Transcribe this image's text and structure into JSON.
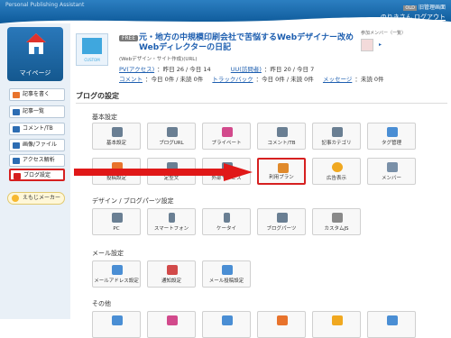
{
  "header": {
    "brand": "Personal Publishing Assistant",
    "old_tag": "OLD",
    "old_link": "旧管理画面",
    "user_name": "のりきさん",
    "logout": "ログアウト"
  },
  "sidebar": {
    "mypage": "マイページ",
    "items": [
      {
        "label": "記事を書く",
        "icon": "pencil-icon",
        "color": "#e8732c"
      },
      {
        "label": "記事一覧",
        "icon": "list-icon",
        "color": "#2d6db3"
      },
      {
        "label": "コメント/TB",
        "icon": "comment-icon",
        "color": "#2d6db3"
      },
      {
        "label": "画像/ファイル",
        "icon": "image-icon",
        "color": "#2d6db3"
      },
      {
        "label": "アクセス解析",
        "icon": "bar-chart-icon",
        "color": "#2d6db3"
      },
      {
        "label": "ブログ設定",
        "icon": "wrench-icon",
        "color": "#d62020"
      }
    ],
    "ebiji": "えもじメーカー"
  },
  "blog": {
    "thumb_label": "CUSTOM",
    "plan_badge": "FREE",
    "title": "元・地方の中規模印刷会社で苦悩するWebデザイナー改めWebディレクターの日記",
    "subtitle": "(Webデザイン・サイト作成)(URL)",
    "pv_label": "PV(アクセス)",
    "pv_value": "：昨日 26 / 今日 14",
    "uu_label": "UU(訪問者)",
    "uu_value": "：昨日 20 / 今日 7",
    "comment_label": "コメント",
    "comment_value": "：今日 0件 / 未読 0件",
    "tb_label": "トラックバック",
    "tb_value": "：今日 0件 / 未読 0件",
    "msg_label": "メッセージ",
    "msg_value": "：未読 0件",
    "member_label": "参加メンバー（一覧）"
  },
  "settings": {
    "section_title": "ブログの設定",
    "groups": [
      {
        "title": "基本設定",
        "tiles": [
          {
            "label": "基本設定",
            "icon": "document-icon",
            "color": "#6a7f93"
          },
          {
            "label": "ブログURL",
            "icon": "globe-icon",
            "color": "#6a7f93"
          },
          {
            "label": "プライベート",
            "icon": "lock-icon",
            "color": "#d24a8c"
          },
          {
            "label": "コメント/TB",
            "icon": "comment-icon",
            "color": "#6a7f93"
          },
          {
            "label": "記事カテゴリ",
            "icon": "folder-icon",
            "color": "#6a7f93"
          },
          {
            "label": "タグ管理",
            "icon": "tag-icon",
            "color": "#4a8ed4"
          }
        ]
      },
      {
        "title": "",
        "tiles": [
          {
            "label": "投稿設定",
            "icon": "pencil-icon",
            "color": "#e8732c"
          },
          {
            "label": "定型文",
            "icon": "text-icon",
            "color": "#6a7f93"
          },
          {
            "label": "外部サービス",
            "icon": "plug-icon",
            "color": "#6a7f93"
          },
          {
            "label": "利用プラン",
            "icon": "plan-icon",
            "color": "#e08a2c",
            "highlight": true
          },
          {
            "label": "広告表示",
            "icon": "ad-icon",
            "color": "#f0a820"
          },
          {
            "label": "メンバー",
            "icon": "users-icon",
            "color": "#7a90a8"
          }
        ]
      },
      {
        "title": "デザイン / ブログパーツ設定",
        "tiles": [
          {
            "label": "PC",
            "icon": "monitor-icon",
            "color": "#6a7f93"
          },
          {
            "label": "スマートフォン",
            "icon": "smartphone-icon",
            "color": "#6a7f93"
          },
          {
            "label": "ケータイ",
            "icon": "phone-icon",
            "color": "#6a7f93"
          },
          {
            "label": "ブログパーツ",
            "icon": "parts-icon",
            "color": "#6a7f93"
          },
          {
            "label": "カスタムJS",
            "icon": "js-icon",
            "color": "#8a8a8a"
          }
        ]
      },
      {
        "title": "メール設定",
        "tiles": [
          {
            "label": "メールアドレス設定",
            "icon": "mail-icon",
            "color": "#4a8ed4"
          },
          {
            "label": "通知設定",
            "icon": "mail-notify-icon",
            "color": "#d24a4a"
          },
          {
            "label": "メール投稿設定",
            "icon": "mail-post-icon",
            "color": "#4a8ed4"
          }
        ]
      },
      {
        "title": "その他",
        "tiles": [
          {
            "label": "",
            "icon": "other-icon-1",
            "color": "#4a8ed4"
          },
          {
            "label": "",
            "icon": "other-icon-2",
            "color": "#d24a8c"
          },
          {
            "label": "",
            "icon": "other-icon-3",
            "color": "#4a8ed4"
          },
          {
            "label": "",
            "icon": "other-icon-4",
            "color": "#e8732c"
          },
          {
            "label": "",
            "icon": "other-icon-5",
            "color": "#f0a820"
          },
          {
            "label": "",
            "icon": "other-icon-6",
            "color": "#4a8ed4"
          }
        ]
      }
    ]
  }
}
